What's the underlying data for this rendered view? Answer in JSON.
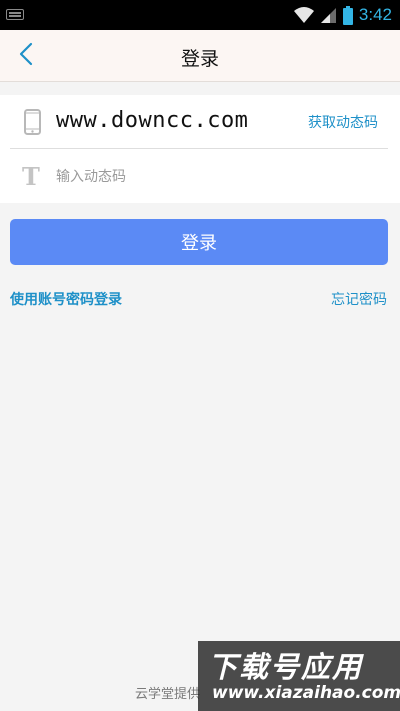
{
  "status_bar": {
    "time": "3:42",
    "icons": [
      "keyboard-icon",
      "wifi-icon",
      "signal-icon",
      "battery-icon"
    ]
  },
  "header": {
    "title": "登录",
    "back_icon": "chevron-left-icon"
  },
  "form": {
    "phone": {
      "icon": "phone-icon",
      "value": "www.downcc.com"
    },
    "get_code_label": "获取动态码",
    "code": {
      "icon": "text-t-icon",
      "placeholder": "输入动态码"
    }
  },
  "login_button": "登录",
  "links": {
    "account_login": "使用账号密码登录",
    "forgot_password": "忘记密码"
  },
  "footer": {
    "text": "云学堂提供"
  },
  "watermark": {
    "top": "下载号应用",
    "bottom": "www.xiazaihao.com"
  },
  "colors": {
    "accent": "#1e90c8",
    "button": "#5b8af5",
    "clock": "#33b5e5",
    "header_bg": "#fcf6f3",
    "page_bg": "#f4f4f4"
  }
}
